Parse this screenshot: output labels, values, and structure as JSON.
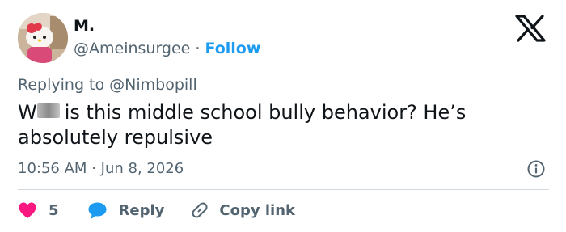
{
  "author": {
    "name": "M.",
    "handle": "@Ameinsurgee",
    "separator": "·",
    "follow_label": "Follow"
  },
  "replying_to": "Replying to @Nimbopill",
  "tweet": {
    "text_rest": "is this middle school bully behavior? He’s absolutely repulsive"
  },
  "meta": {
    "time": "10:56 AM",
    "separator": "·",
    "date": "Jun 8, 2026"
  },
  "actions": {
    "like_count": "5",
    "reply_label": "Reply",
    "copy_label": "Copy link"
  },
  "colors": {
    "accent": "#1d9bf0",
    "like": "#f91880",
    "muted_text": "#536471",
    "primary_text": "#0f1419",
    "divider": "#cfd9de"
  },
  "icons": {
    "logo": "x-logo-icon",
    "info": "info-icon",
    "like": "heart-icon",
    "reply": "chat-bubble-icon",
    "copy": "link-icon"
  }
}
